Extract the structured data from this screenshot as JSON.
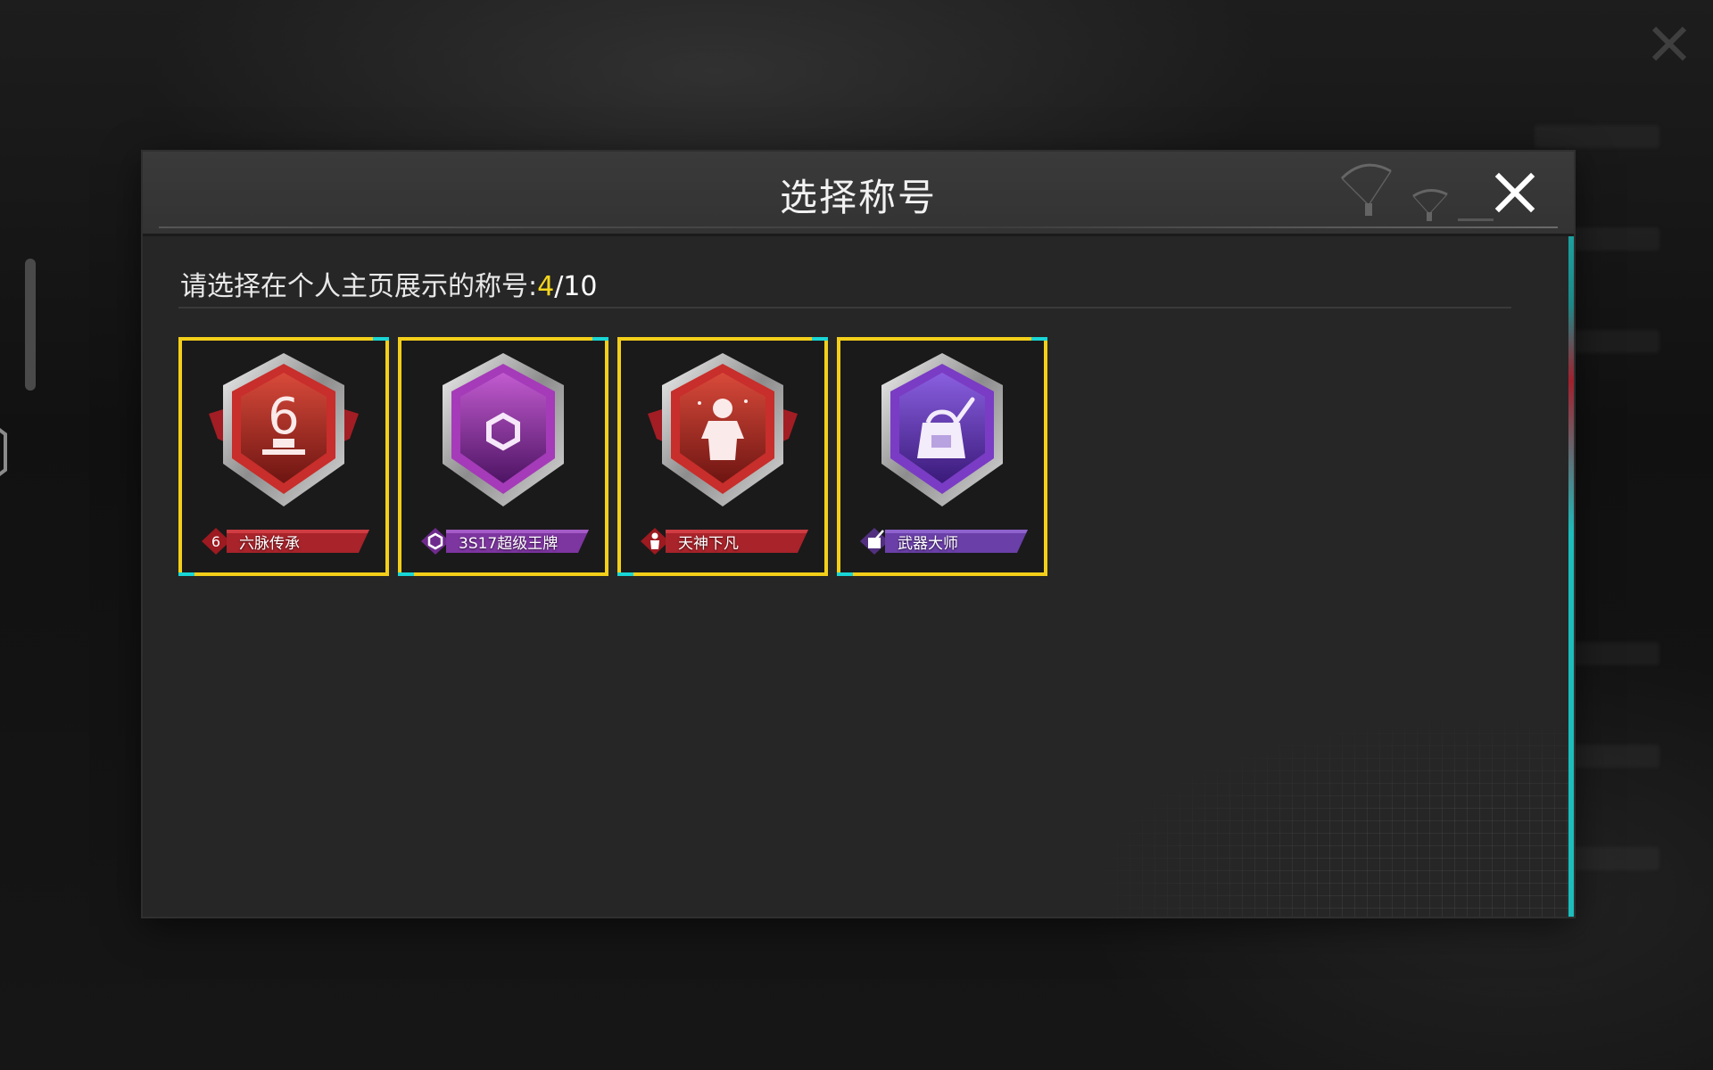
{
  "modal": {
    "title": "选择称号",
    "prompt_label": "请选择在个人主页展示的称号:",
    "selected_count": "4",
    "total_count": "/10"
  },
  "cards": [
    {
      "label": "六脉传承",
      "theme": "red",
      "icon": "six-trophy-icon"
    },
    {
      "label": "3S17超级王牌",
      "theme": "purple",
      "icon": "hexagon-emblem-icon"
    },
    {
      "label": "天神下凡",
      "theme": "red",
      "icon": "soldier-silhouette-icon"
    },
    {
      "label": "武器大师",
      "theme": "purple",
      "icon": "weapon-backpack-icon"
    }
  ],
  "colors": {
    "selection_border": "#f3cf1a",
    "count_highlight": "#f5d61c",
    "corner_accent": "#19d6d6",
    "red_theme": "#b3232c",
    "purple_theme": "#8a3fc0"
  }
}
